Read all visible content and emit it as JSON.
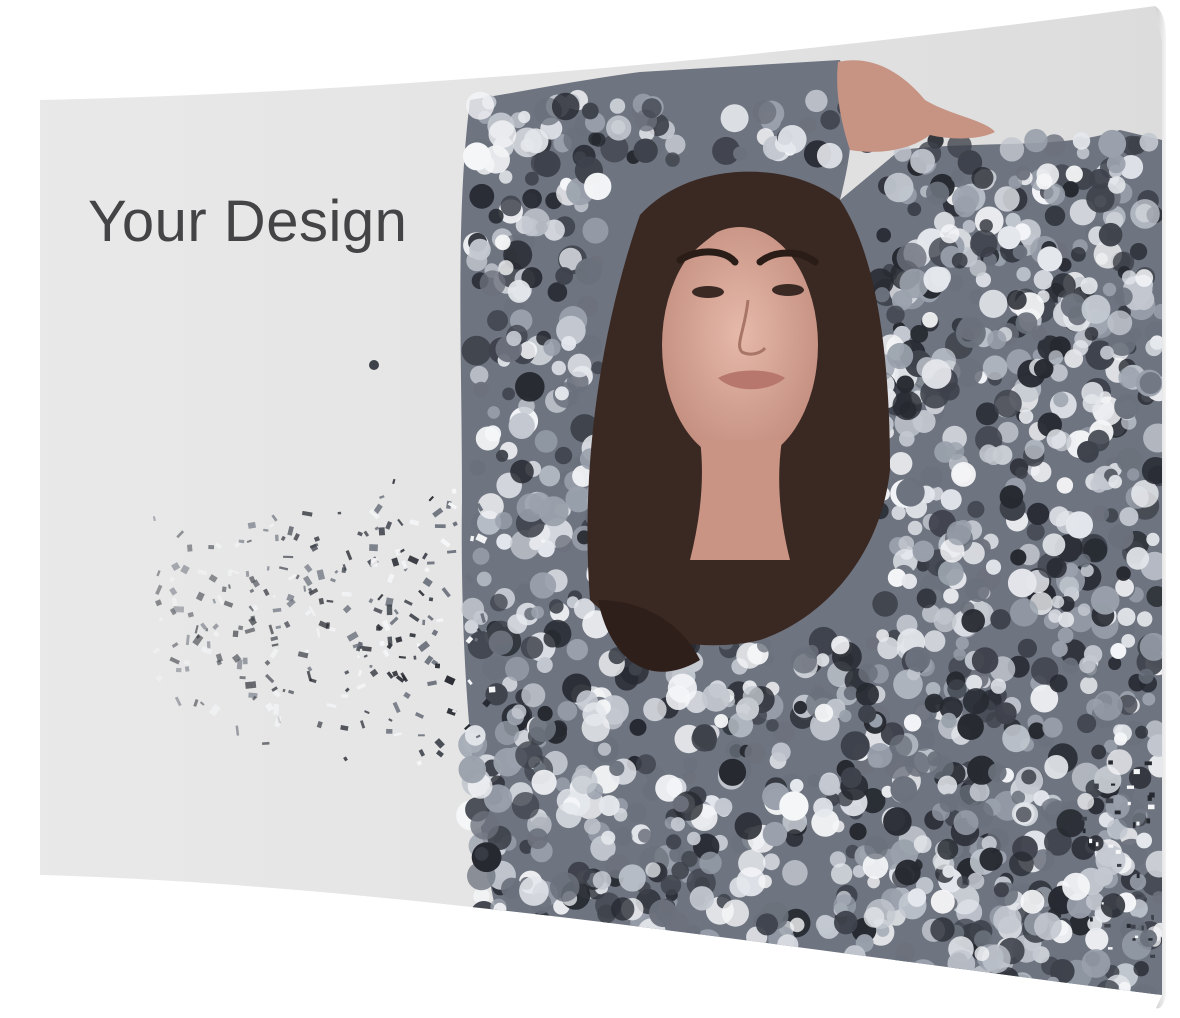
{
  "banner": {
    "headline": "Your Design"
  },
  "colors": {
    "backdrop": "#e6e6e6",
    "sequin_light": "#d8dce2",
    "sequin_mid": "#8d94a0",
    "sequin_dark": "#2c2f37",
    "hair": "#3a2822",
    "skin": "#d9a99a",
    "text": "#444446"
  },
  "icons": {
    "photo": "woman-in-sequin-dress-photo"
  }
}
